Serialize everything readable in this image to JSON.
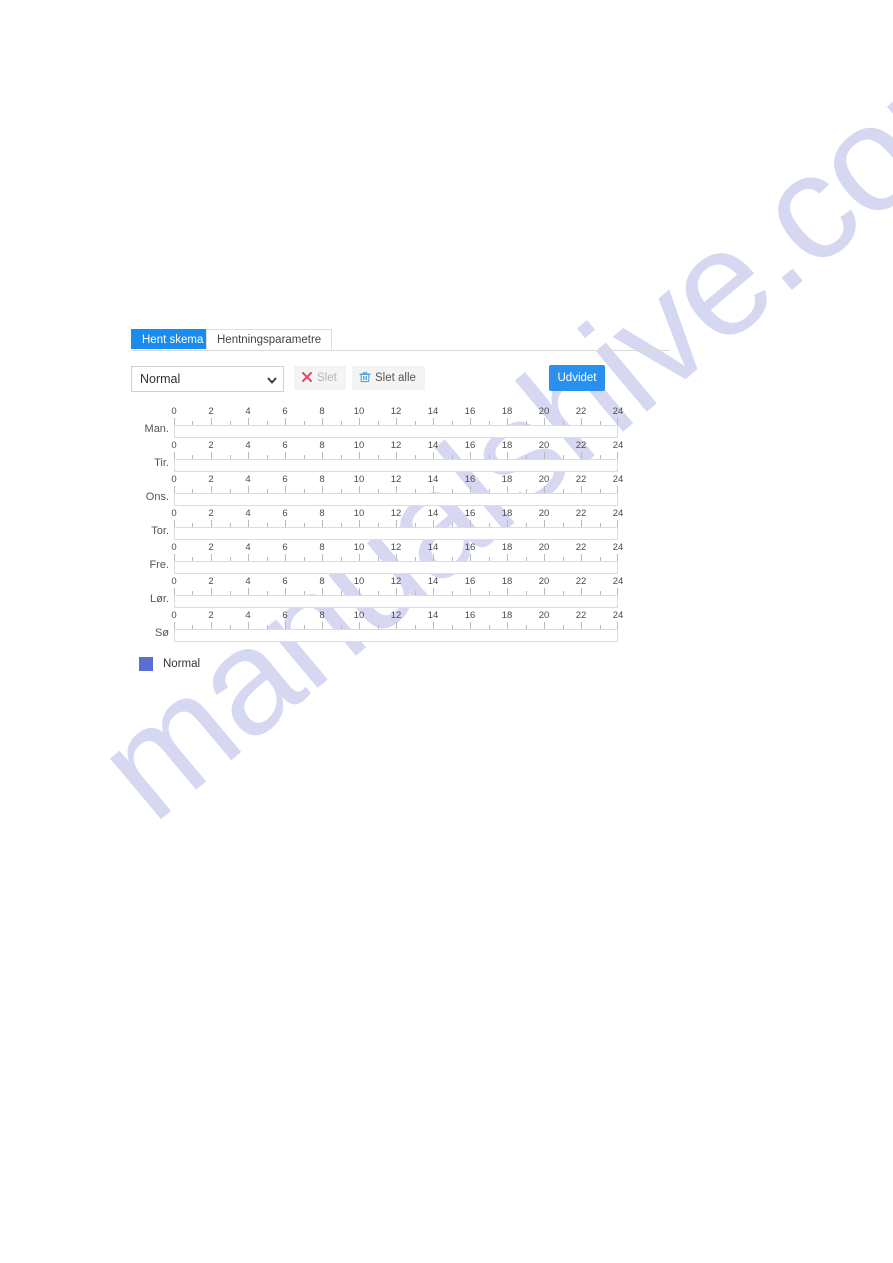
{
  "watermark": {
    "text": "manualshive.com"
  },
  "tabs": [
    {
      "label": "Hent skema",
      "active": true
    },
    {
      "label": "Hentningsparametre",
      "active": false
    }
  ],
  "toolbar": {
    "schedule_type_value": "Normal",
    "schedule_type_options": [
      "Normal"
    ],
    "delete_label": "Slet",
    "delete_icon": "close-x-icon",
    "delete_all_label": "Slet alle",
    "delete_all_icon": "trash-icon",
    "advanced_label": "Udvidet",
    "dropdown_icon": "chevron-down-icon"
  },
  "schedule": {
    "hour_labels": [
      "0",
      "2",
      "4",
      "6",
      "8",
      "10",
      "12",
      "14",
      "16",
      "18",
      "20",
      "22",
      "24"
    ],
    "hour_min": 0,
    "hour_max": 24,
    "days": [
      {
        "label": "Man.",
        "segments": []
      },
      {
        "label": "Tir.",
        "segments": []
      },
      {
        "label": "Ons.",
        "segments": []
      },
      {
        "label": "Tor.",
        "segments": []
      },
      {
        "label": "Fre.",
        "segments": []
      },
      {
        "label": "Lør.",
        "segments": []
      },
      {
        "label": "Sø",
        "segments": []
      }
    ]
  },
  "legend": [
    {
      "label": "Normal",
      "color": "#5a6fd6"
    }
  ],
  "colors": {
    "accent_blue": "#2a90f0",
    "tab_active_blue": "#1a8cf0",
    "legend_normal": "#5a6fd6",
    "delete_x_red": "#e8456a",
    "trash_blue": "#3f9ae0",
    "watermark": "#c9cbee"
  }
}
